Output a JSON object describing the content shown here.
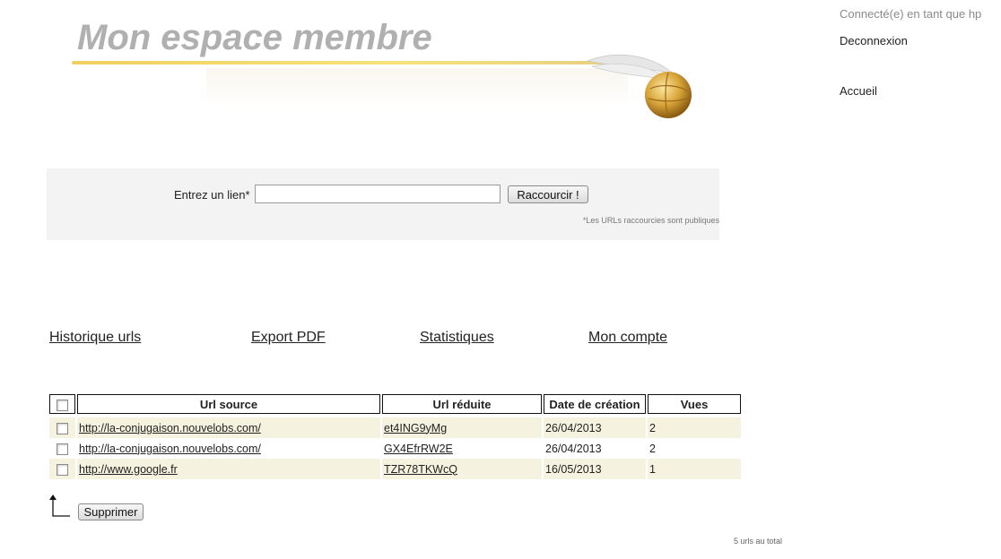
{
  "banner": {
    "title": "Mon espace membre"
  },
  "user": {
    "connected": "Connecté(e) en tant que hp",
    "logout": "Deconnexion",
    "home": "Accueil"
  },
  "shortener": {
    "label": "Entrez un lien*",
    "input_value": "",
    "button": "Raccourcir !",
    "note": "*Les URLs raccourcies sont publiques"
  },
  "nav": {
    "history": "Historique urls",
    "export": "Export PDF",
    "stats": "Statistiques",
    "account": "Mon compte"
  },
  "table": {
    "headers": [
      "Url source",
      "Url réduite",
      "Date de création",
      "Vues"
    ],
    "rows": [
      {
        "source": "http://la-conjugaison.nouvelobs.com/",
        "short": "et4ING9yMg",
        "date": "26/04/2013",
        "views": "2"
      },
      {
        "source": "http://la-conjugaison.nouvelobs.com/",
        "short": "GX4EfrRW2E",
        "date": "26/04/2013",
        "views": "2"
      },
      {
        "source": "http://www.google.fr",
        "short": "TZR78TKWcQ",
        "date": "16/05/2013",
        "views": "1"
      }
    ]
  },
  "actions": {
    "delete": "Supprimer"
  },
  "footer": {
    "total": "5 urls au total"
  }
}
